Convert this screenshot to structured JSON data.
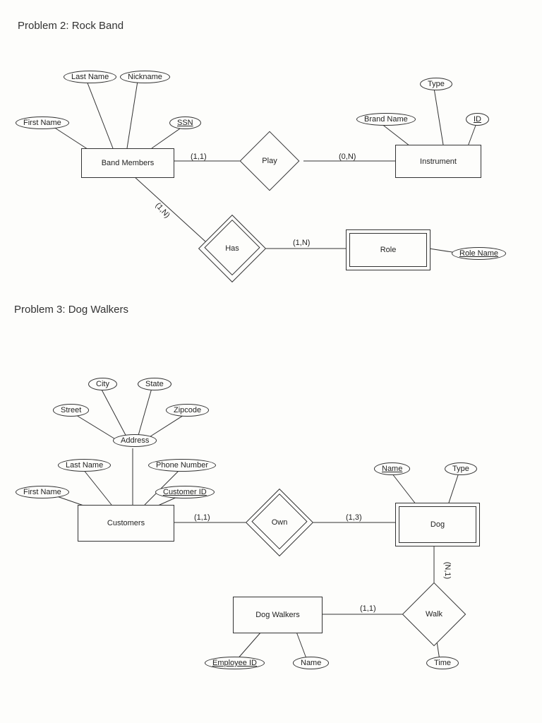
{
  "headings": {
    "problem2": "Problem 2: Rock Band",
    "problem3": "Problem 3: Dog Walkers"
  },
  "p2": {
    "entities": {
      "band_members": "Band Members",
      "instrument": "Instrument",
      "role": "Role"
    },
    "relationships": {
      "play": "Play",
      "has": "Has"
    },
    "attributes": {
      "last_name": "Last Name",
      "nickname": "Nickname",
      "first_name": "First Name",
      "ssn": "SSN",
      "brand_name": "Brand Name",
      "type": "Type",
      "id": "ID",
      "role_name": "Role Name"
    },
    "cardinalities": {
      "bm_play": "(1,1)",
      "play_inst": "(0,N)",
      "bm_has": "(1,N)",
      "has_role": "(1,N)"
    }
  },
  "p3": {
    "entities": {
      "customers": "Customers",
      "dog": "Dog",
      "dog_walkers": "Dog Walkers"
    },
    "relationships": {
      "own": "Own",
      "walk": "Walk"
    },
    "attributes": {
      "city": "City",
      "state": "State",
      "street": "Street",
      "zipcode": "Zipcode",
      "address": "Address",
      "last_name": "Last Name",
      "phone_number": "Phone Number",
      "first_name": "First Name",
      "customer_id": "Customer ID",
      "name_dog": "Name",
      "type_dog": "Type",
      "employee_id": "Employee ID",
      "name_walker": "Name",
      "time": "Time"
    },
    "cardinalities": {
      "cust_own": "(1,1)",
      "own_dog": "(1,3)",
      "dog_walk": "(N,1)",
      "walk_dw": "(1,1)"
    }
  }
}
